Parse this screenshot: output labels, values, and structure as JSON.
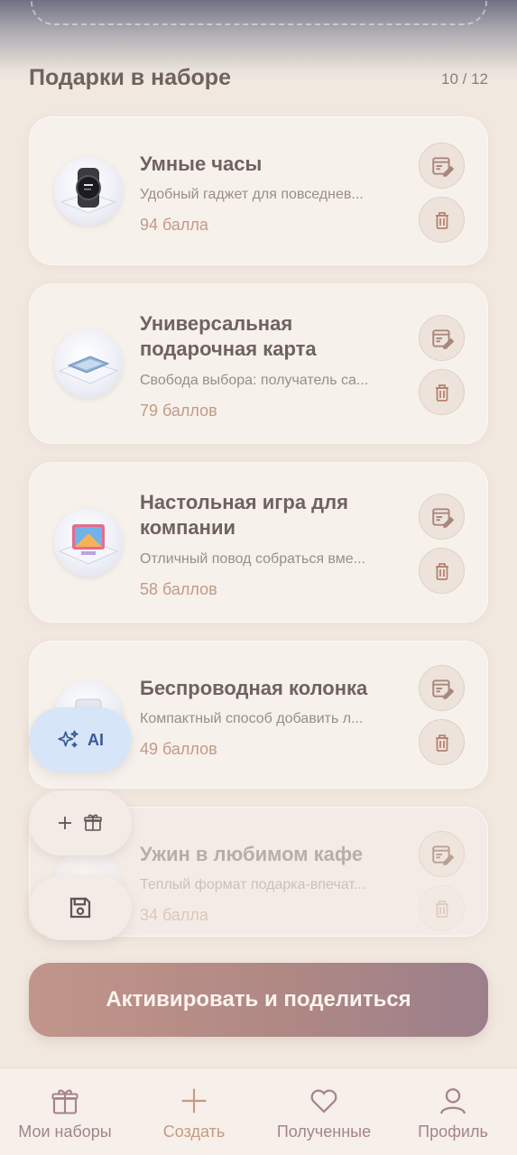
{
  "section": {
    "title": "Подарки в наборе",
    "counter": "10 / 12"
  },
  "gifts": [
    {
      "title": "Умные часы",
      "description": "Удобный гаджет для повседнев...",
      "points": "94 балла"
    },
    {
      "title": "Универсальная подарочная карта",
      "description": "Свобода выбора: получатель са...",
      "points": "79 баллов"
    },
    {
      "title": "Настольная игра для компании",
      "description": "Отличный повод собраться вме...",
      "points": "58 баллов"
    },
    {
      "title": "Беспроводная колонка",
      "description": "Компактный способ добавить л...",
      "points": "49 баллов"
    },
    {
      "title": "Ужин в любимом кафе",
      "description": "Теплый формат подарка-впечат...",
      "points": "34 балла"
    }
  ],
  "fab": {
    "ai_label": "AI"
  },
  "cta": {
    "label": "Активировать и поделиться"
  },
  "nav": [
    {
      "label": "Мои наборы",
      "icon": "gift-icon"
    },
    {
      "label": "Создать",
      "icon": "plus-icon"
    },
    {
      "label": "Полученные",
      "icon": "heart-icon"
    },
    {
      "label": "Профиль",
      "icon": "user-icon"
    }
  ],
  "colors": {
    "background": "#f1e8df",
    "accent": "#c39a87",
    "ai_fab": "#d6e5f7",
    "cta_gradient_start": "#c1958a",
    "cta_gradient_end": "#9b7f8b"
  }
}
